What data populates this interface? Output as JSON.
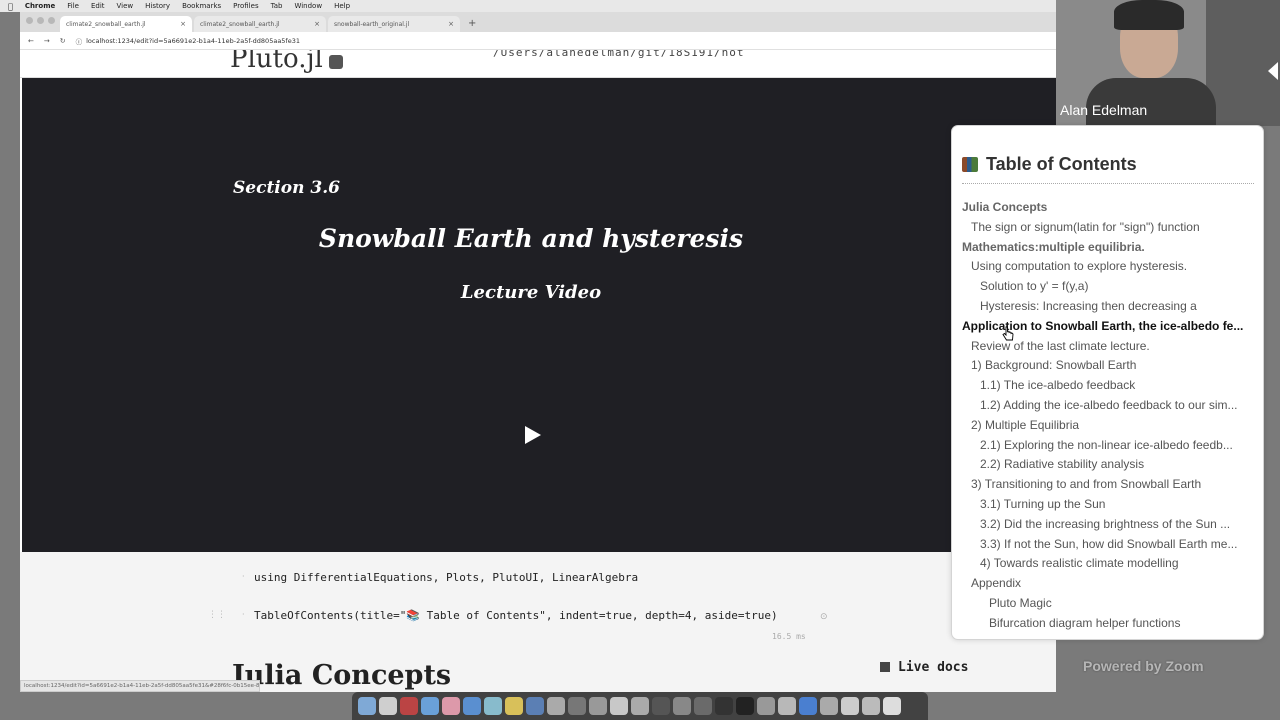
{
  "menubar": {
    "app_name": "Chrome",
    "items": [
      "File",
      "Edit",
      "View",
      "History",
      "Bookmarks",
      "Profiles",
      "Tab",
      "Window",
      "Help"
    ]
  },
  "browser": {
    "tabs": [
      {
        "label": "climate2_snowball_earth.jl"
      },
      {
        "label": "climate2_snowball_earth.jl"
      },
      {
        "label": "snowball-earth_original.jl"
      }
    ],
    "new_tab": "+",
    "url": "localhost:1234/edit?id=5a6691e2-b1a4-11eb-2a5f-dd805aa5fe31"
  },
  "pluto": {
    "logo_text": "Pluto.jl",
    "notebook_path": "/Users/alanedelman/git/18S191/not"
  },
  "video_cell": {
    "section": "Section 3.6",
    "title": "Snowball Earth and hysteresis",
    "subtitle": "Lecture Video"
  },
  "code_cells": {
    "line1": "using DifferentialEquations, Plots, PlutoUI, LinearAlgebra",
    "line2": "TableOfContents(title=\"📚 Table of Contents\", indent=true, depth=4, aside=true)",
    "run_time": "16.5 ms"
  },
  "julia_heading": "Julia Concepts",
  "live_docs": "Live docs",
  "statusbar_url": "localhost:1234/edit?id=5a6691e2-b1a4-11eb-2a5f-dd805aa5fe31&#28f6fc-0b15ee-8022-4280-b424-ff1b5d57245",
  "zoom": {
    "participant_name": "Alan Edelman",
    "watermark": "Powered by Zoom"
  },
  "toc": {
    "title": "Table of Contents",
    "items": [
      {
        "label": "Julia Concepts",
        "level": 1
      },
      {
        "label": "The sign or signum(latin for \"sign\") function",
        "level": 2
      },
      {
        "label": "Mathematics:multiple equilibria.",
        "level": 1
      },
      {
        "label": "Using computation to explore hysteresis.",
        "level": 2
      },
      {
        "label": "Solution to y' = f(y,a)",
        "level": 3
      },
      {
        "label": "Hysteresis: Increasing then decreasing a",
        "level": 3
      },
      {
        "label": "Application to Snowball Earth, the ice-albedo fe...",
        "level": 1,
        "active": true
      },
      {
        "label": "Review of the last climate lecture.",
        "level": 2
      },
      {
        "label": "1) Background: Snowball Earth",
        "level": 2
      },
      {
        "label": "1.1) The ice-albedo feedback",
        "level": 3
      },
      {
        "label": "1.2) Adding the ice-albedo feedback to our sim...",
        "level": 3
      },
      {
        "label": "2) Multiple Equilibria",
        "level": 2
      },
      {
        "label": "2.1) Exploring the non-linear ice-albedo feedb...",
        "level": 3
      },
      {
        "label": "2.2) Radiative stability analysis",
        "level": 3
      },
      {
        "label": "3) Transitioning to and from Snowball Earth",
        "level": 2
      },
      {
        "label": "3.1) Turning up the Sun",
        "level": 3
      },
      {
        "label": "3.2) Did the increasing brightness of the Sun ...",
        "level": 3
      },
      {
        "label": "3.3) If not the Sun, how did Snowball Earth me...",
        "level": 3
      },
      {
        "label": "4) Towards realistic climate modelling",
        "level": 3
      },
      {
        "label": "Appendix",
        "level": 2
      },
      {
        "label": "Pluto Magic",
        "level": 4
      },
      {
        "label": "Bifurcation diagram helper functions",
        "level": 4
      }
    ]
  }
}
